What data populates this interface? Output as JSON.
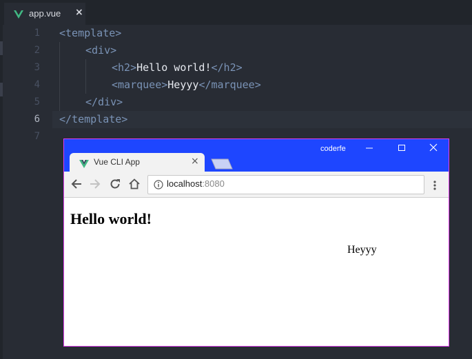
{
  "editor": {
    "tab": {
      "file_name": "app.vue",
      "close_glyph": "×"
    },
    "line_numbers": [
      "1",
      "2",
      "3",
      "4",
      "5",
      "6",
      "7"
    ],
    "active_line": "6",
    "lines": {
      "l1": {
        "open": "<template>"
      },
      "l2": {
        "open": "<div>"
      },
      "l3": {
        "open": "<h2>",
        "text": "Hello world!",
        "close": "</h2>"
      },
      "l4": {
        "open": "<marquee>",
        "text": "Heyyy",
        "close": "</marquee>"
      },
      "l5": {
        "close": "</div>"
      },
      "l6": {
        "close": "</template>"
      }
    },
    "colors": {
      "background": "#282c34",
      "tag": "#7a93b6",
      "text": "#e6e9ef",
      "vue_logo": "#41b883"
    }
  },
  "browser": {
    "profile_name": "coderfe",
    "window_controls": {
      "minimize": "—",
      "maximize": "☐",
      "close": "✕"
    },
    "tab": {
      "title": "Vue CLI App",
      "close_glyph": "×"
    },
    "address": {
      "host": "localhost",
      "port": ":8080"
    },
    "page": {
      "heading": "Hello world!",
      "marquee_text": "Heyyy"
    },
    "colors": {
      "frame": "#1e46ff",
      "border": "#e23ef3"
    }
  }
}
